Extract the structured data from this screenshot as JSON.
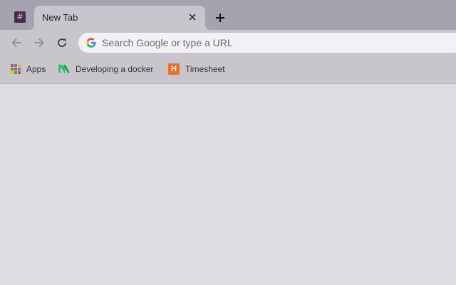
{
  "tabstrip": {
    "pinned_tab": {
      "favicon_glyph": "#",
      "favicon_color": "#4a2d4b"
    },
    "active_tab": {
      "title": "New Tab"
    },
    "new_tab_icon": "plus-icon"
  },
  "toolbar": {
    "back_icon": "arrow-left-icon",
    "forward_icon": "arrow-right-icon",
    "reload_icon": "reload-icon",
    "omnibox": {
      "placeholder": "Search Google or type a URL",
      "search_engine_icon": "google-g-icon"
    }
  },
  "bookmarks": {
    "items": [
      {
        "label": "Apps",
        "icon": "apps-grid-icon"
      },
      {
        "label": "Developing a docker",
        "icon": "medium-m-icon"
      },
      {
        "label": "Timesheet",
        "icon": "h-logo-icon",
        "glyph": "H"
      }
    ]
  },
  "colors": {
    "tabstrip_bg": "#a5a3ad",
    "toolbar_bg": "#c8c6cc",
    "content_bg": "#dedce1",
    "omnibox_bg": "#f2f1f4",
    "timesheet_orange": "#e8712a"
  }
}
